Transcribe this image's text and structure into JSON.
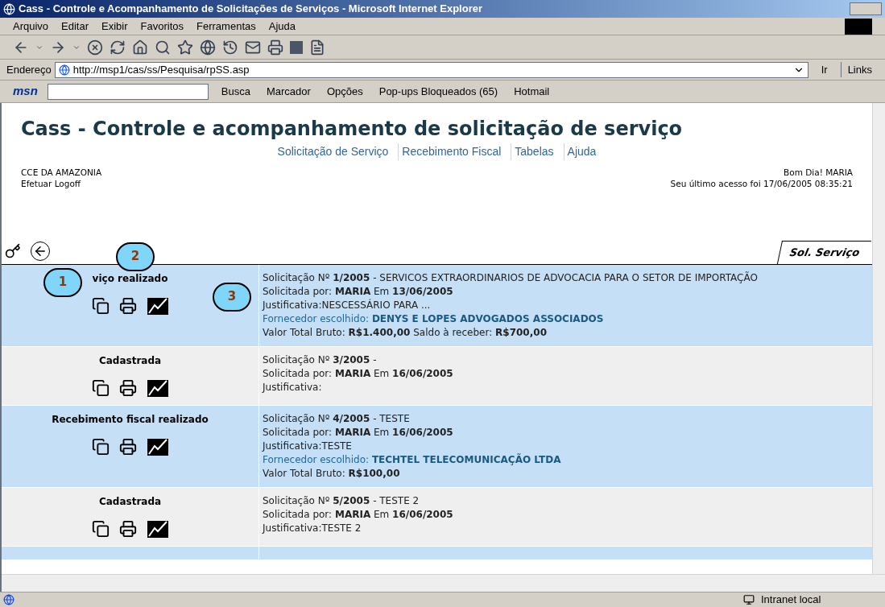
{
  "window": {
    "title": "Cass - Controle e Acompanhamento de Solicitações de Serviços - Microsoft Internet Explorer"
  },
  "menu": [
    "Arquivo",
    "Editar",
    "Exibir",
    "Favoritos",
    "Ferramentas",
    "Ajuda"
  ],
  "address": {
    "label": "Endereço",
    "value": "http://msp1/cas/ss/Pesquisa/rpSS.asp",
    "go": "Ir",
    "links": "Links"
  },
  "msn_bar": {
    "logo": "msn",
    "items": [
      "Busca",
      "Marcador",
      "Opções",
      "Pop-ups Bloqueados (65)",
      "Hotmail"
    ]
  },
  "page": {
    "heading": "Cass - Controle e acompanhamento de solicitação de serviço",
    "nav": [
      "Solicitação de Serviço",
      "Recebimento Fiscal",
      "Tabelas",
      "Ajuda"
    ],
    "company": "CCE DA AMAZONIA",
    "logoff": "Efetuar Logoff",
    "greeting": "Bom Dia! MARIA",
    "last_access": "Seu último acesso foi 17/06/2005 08:35:21",
    "tab": "Sol. Serviço"
  },
  "callouts": [
    "1",
    "2",
    "3"
  ],
  "rows": [
    {
      "highlighted": true,
      "status": "viço realizado",
      "lines": [
        {
          "kind": "plain",
          "text": "Solicitação Nº **1/2005** - SERVICOS EXTRAORDINARIOS DE ADVOCACIA PARA O SETOR DE IMPORTAÇÃO"
        },
        {
          "kind": "plain",
          "text": "Solicitada por: **MARIA**  Em **13/06/2005**"
        },
        {
          "kind": "plain",
          "text": "Justificativa:NESCESSÁRIO PARA ..."
        },
        {
          "kind": "supplier",
          "text": "Fornecedor escolhido: **DENYS E LOPES ADVOGADOS ASSOCIADOS**"
        },
        {
          "kind": "plain",
          "text": "Valor Total Bruto: **R$1.400,00**  Saldo à receber: **R$700,00**"
        }
      ]
    },
    {
      "highlighted": false,
      "status": "Cadastrada",
      "lines": [
        {
          "kind": "plain",
          "text": "Solicitação Nº **3/2005** -"
        },
        {
          "kind": "plain",
          "text": "Solicitada por: **MARIA**  Em **16/06/2005**"
        },
        {
          "kind": "plain",
          "text": "Justificativa:"
        }
      ]
    },
    {
      "highlighted": true,
      "status": "Recebimento fiscal realizado",
      "lines": [
        {
          "kind": "plain",
          "text": "Solicitação Nº **4/2005** - TESTE"
        },
        {
          "kind": "plain",
          "text": "Solicitada por: **MARIA**  Em **16/06/2005**"
        },
        {
          "kind": "plain",
          "text": "Justificativa:TESTE"
        },
        {
          "kind": "supplier",
          "text": "Fornecedor escolhido: **TECHTEL TELECOMUNICAÇÃO LTDA**"
        },
        {
          "kind": "plain",
          "text": "Valor Total Bruto: **R$100,00**"
        }
      ]
    },
    {
      "highlighted": false,
      "status": "Cadastrada",
      "lines": [
        {
          "kind": "plain",
          "text": "Solicitação Nº **5/2005** - TESTE 2"
        },
        {
          "kind": "plain",
          "text": "Solicitada por: **MARIA**  Em **16/06/2005**"
        },
        {
          "kind": "plain",
          "text": "Justificativa:TESTE 2"
        }
      ]
    },
    {
      "highlighted": true,
      "status": "",
      "lines": []
    }
  ],
  "status_bar": {
    "zone": "Intranet local"
  }
}
